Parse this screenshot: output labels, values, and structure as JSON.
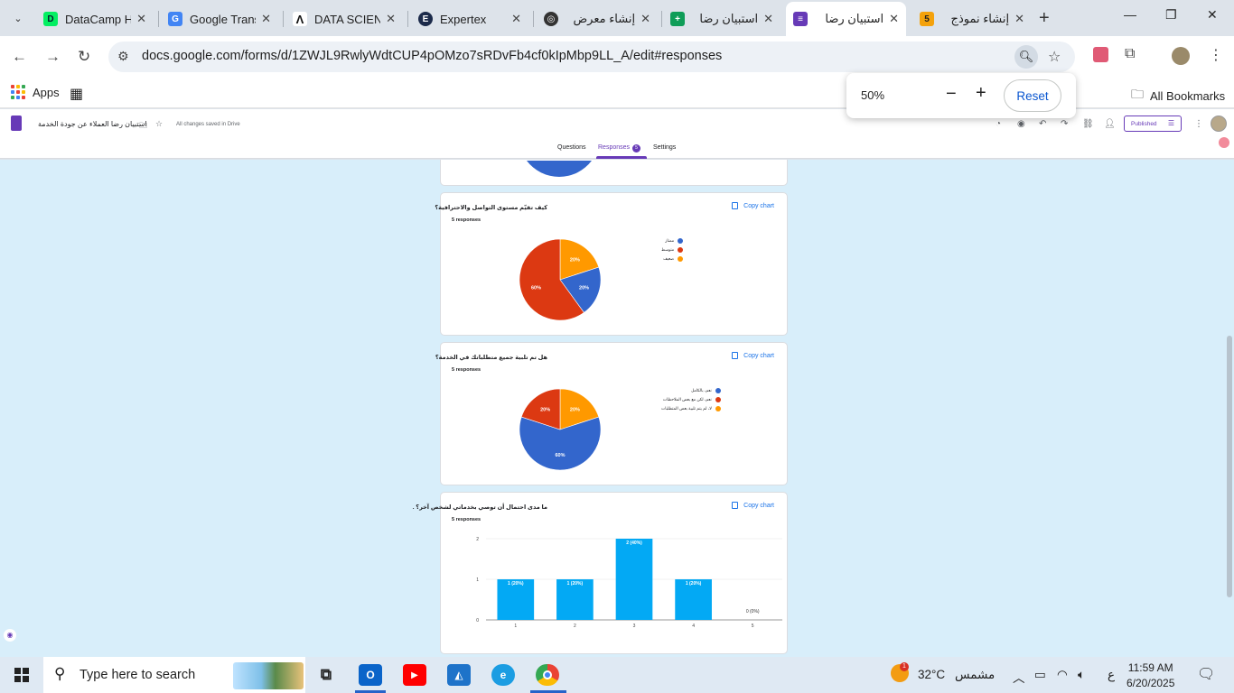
{
  "tabs": [
    {
      "title": "DataCamp H",
      "color": "#03ef62",
      "glyph": "D"
    },
    {
      "title": "Google Trans",
      "color": "#4285f4",
      "glyph": "G"
    },
    {
      "title": "DATA SCIENC",
      "color": "#ffffff",
      "glyph": "Λ"
    },
    {
      "title": "Expertex",
      "color": "#1b2a4a",
      "glyph": "E"
    },
    {
      "title": "إنشاء معرض",
      "color": "#333333",
      "glyph": "◎"
    },
    {
      "title": "استبيان رضا",
      "color": "#0f9d58",
      "glyph": "+"
    },
    {
      "title": "استبيان رضا",
      "color": "#673ab7",
      "glyph": "≡",
      "active": true
    },
    {
      "title": "إنشاء نموذج",
      "color": "#f4a20c",
      "glyph": "5"
    }
  ],
  "address": {
    "url": "docs.google.com/forms/d/1ZWJL9RwlyWdtCUP4pOMzo7sRDvFb4cf0kIpMbp9LL_A/edit#responses"
  },
  "bookmarks": {
    "apps": "Apps",
    "all": "All Bookmarks"
  },
  "zoom": {
    "level": "50%",
    "reset": "Reset"
  },
  "form": {
    "title": "استبيان رضا العملاء عن جودة الخدمة",
    "saved": "All changes saved in Drive",
    "published": "Published",
    "tabs": {
      "questions": "Questions",
      "responses": "Responses",
      "responses_count": "5",
      "settings": "Settings"
    }
  },
  "cards": [
    {
      "question": "كيف تقيّم مستوى التواصل والاحترافية؟",
      "responses": "5 responses",
      "copy": "Copy chart",
      "legend": [
        "ممتاز",
        "متوسط",
        "ضعيف"
      ]
    },
    {
      "question": "هل تم تلبية جميع متطلباتك في الخدمة؟",
      "responses": "5 responses",
      "copy": "Copy chart",
      "legend": [
        "نعم، بالكامل",
        "نعم، لكن مع بعض الملاحظات",
        "لا، لم يتم تلبية بعض المتطلبات"
      ]
    },
    {
      "question": "ما مدى احتمال أن توصي بخدماتي لشخص آخر؟ .",
      "responses": "5 responses",
      "copy": "Copy chart"
    }
  ],
  "chart_data": [
    {
      "type": "pie",
      "categories": [
        "ممتاز",
        "متوسط",
        "ضعيف"
      ],
      "values": [
        20,
        60,
        20
      ],
      "labels": [
        "20%",
        "60%",
        "20%"
      ],
      "colors": [
        "#3366cc",
        "#dc3912",
        "#ff9900"
      ]
    },
    {
      "type": "pie",
      "categories": [
        "نعم، بالكامل",
        "نعم، لكن مع بعض الملاحظات",
        "لا، لم يتم تلبية بعض المتطلبات"
      ],
      "values": [
        60,
        20,
        20
      ],
      "labels": [
        "60%",
        "20%",
        "20%"
      ],
      "colors": [
        "#3366cc",
        "#dc3912",
        "#ff9900"
      ]
    },
    {
      "type": "bar",
      "categories": [
        "1",
        "2",
        "3",
        "4",
        "5"
      ],
      "values": [
        1,
        1,
        2,
        1,
        0
      ],
      "labels": [
        "1 (20%)",
        "1 (20%)",
        "2 (40%)",
        "1 (20%)",
        "0 (0%)"
      ],
      "yticks": [
        "0",
        "1",
        "2"
      ],
      "ylim": [
        0,
        2
      ],
      "color": "#03a9f4"
    }
  ],
  "taskbar": {
    "search": "Type here to search",
    "weather": "32°C",
    "weather_label": "مشمس",
    "lang": "ع",
    "time": "11:59 AM",
    "date": "6/20/2025",
    "notif_count": "1"
  }
}
